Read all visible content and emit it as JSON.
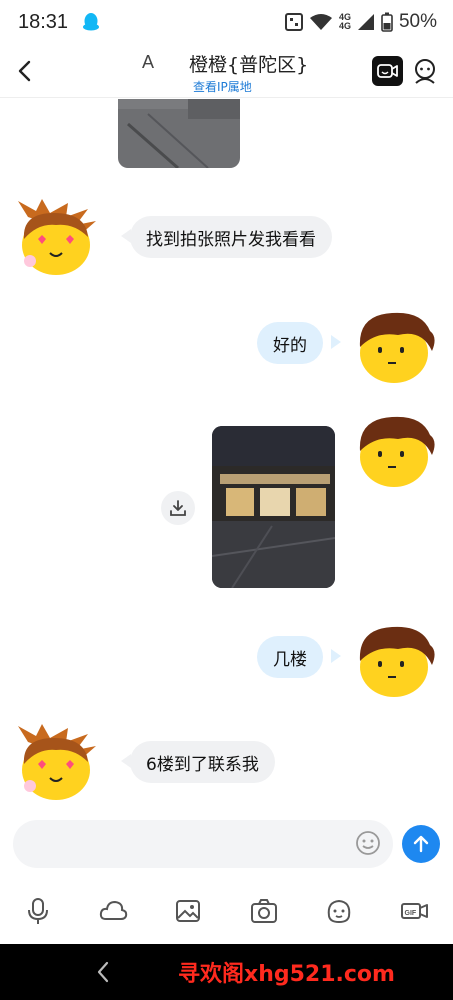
{
  "status_bar": {
    "time": "18:31",
    "network_top": "4G",
    "network_bottom": "4G",
    "battery": "50%"
  },
  "header": {
    "left_letter": "A",
    "title": "橙橙{普陀区}",
    "subtitle": "查看IP属地"
  },
  "messages": [
    {
      "side": "in",
      "type": "text",
      "text": "找到拍张照片发我看看"
    },
    {
      "side": "out",
      "type": "text",
      "text": "好的"
    },
    {
      "side": "out",
      "type": "image"
    },
    {
      "side": "out",
      "type": "text",
      "text": "几楼"
    },
    {
      "side": "in",
      "type": "text",
      "text": "6楼到了联系我"
    }
  ],
  "input": {
    "placeholder": ""
  },
  "toolbar": [
    "microphone-icon",
    "cloud-icon",
    "image-icon",
    "camera-icon",
    "sticker-icon",
    "gif-icon"
  ],
  "watermark": "寻欢阁xhg521.com",
  "colors": {
    "accent": "#1e88f0",
    "link": "#1e7bd6",
    "incoming_bubble": "#f0f1f3",
    "outgoing_bubble": "#dff0fd",
    "watermark": "#ff2a1e"
  }
}
